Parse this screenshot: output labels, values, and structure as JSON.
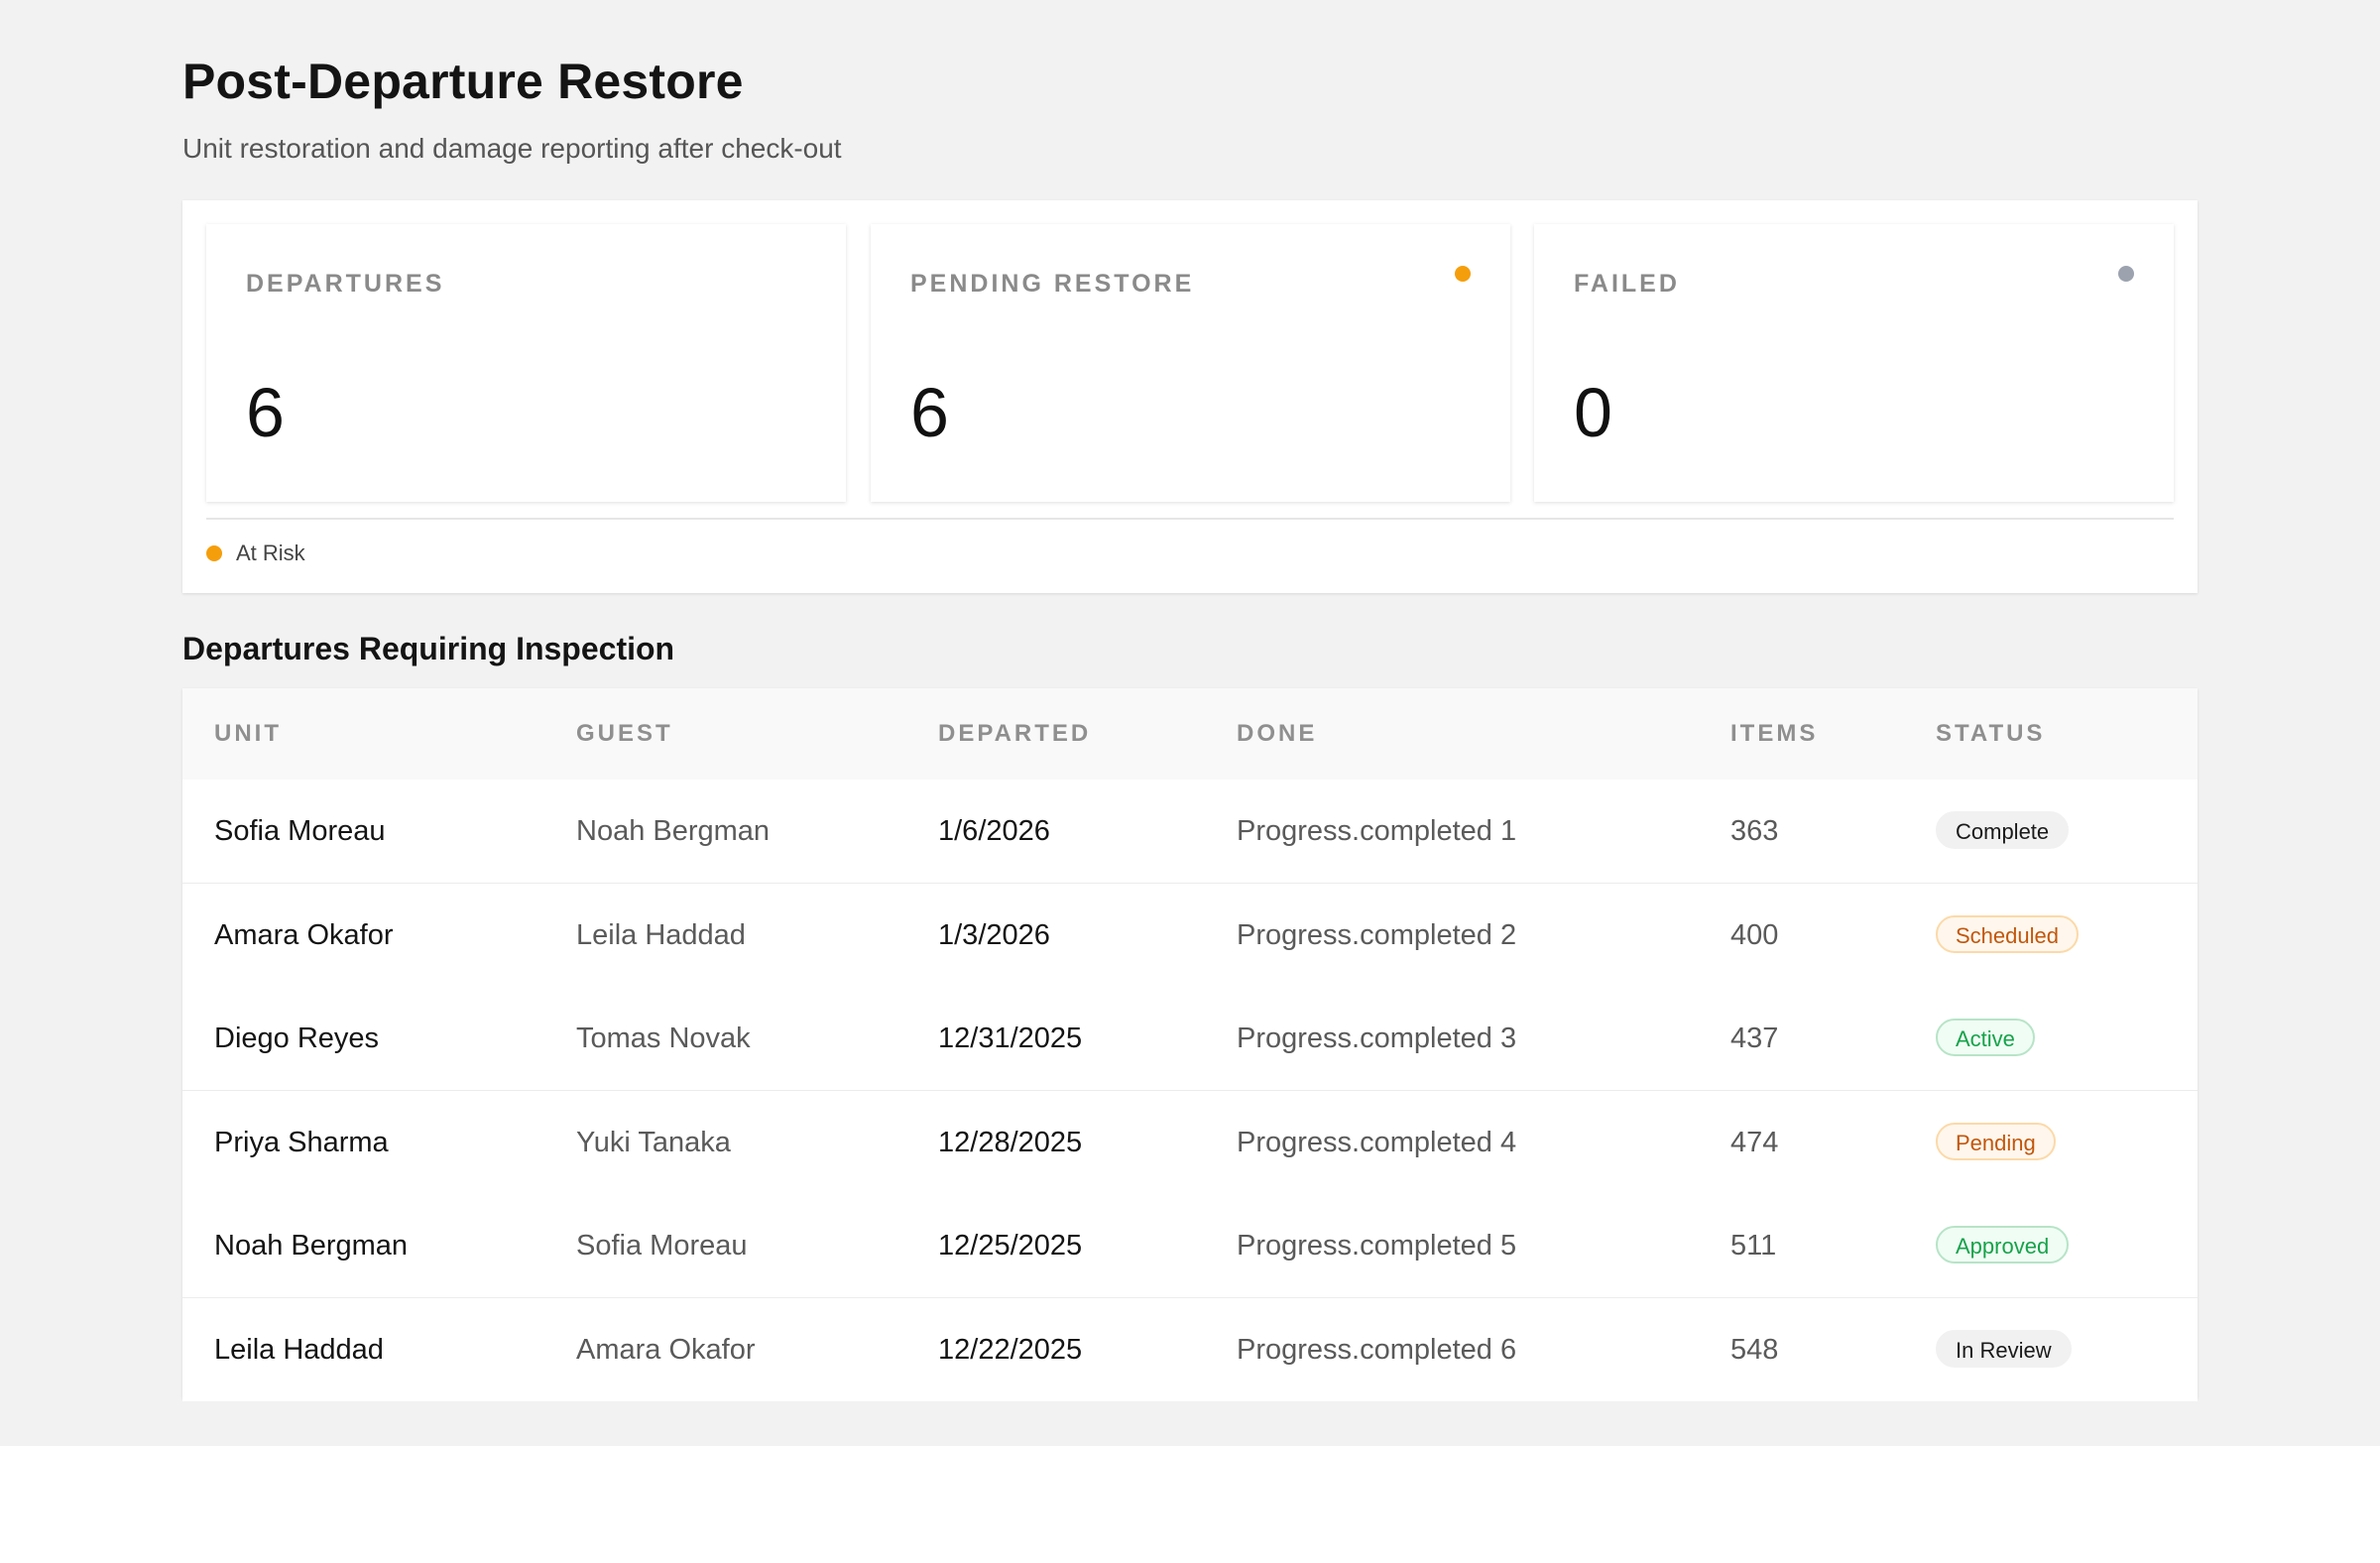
{
  "header": {
    "title": "Post-Departure Restore",
    "subtitle": "Unit restoration and damage reporting after check-out"
  },
  "stats": [
    {
      "label": "DEPARTURES",
      "value": "6"
    },
    {
      "label": "PENDING RESTORE",
      "value": "6",
      "dot_color": "#f59e0b"
    },
    {
      "label": "FAILED",
      "value": "0",
      "dot_color": "#9ca3af"
    }
  ],
  "legend": {
    "label": "At Risk",
    "color": "#f59e0b"
  },
  "table": {
    "title": "Departures Requiring Inspection",
    "columns": [
      "UNIT",
      "GUEST",
      "DEPARTED",
      "DONE",
      "ITEMS",
      "STATUS"
    ],
    "rows": [
      {
        "unit": "Sofia Moreau",
        "guest": "Noah Bergman",
        "departed": "1/6/2026",
        "done": "Progress.completed 1",
        "items": "363",
        "status": "Complete",
        "status_style": "neutral"
      },
      {
        "unit": "Amara Okafor",
        "guest": "Leila Haddad",
        "departed": "1/3/2026",
        "done": "Progress.completed 2",
        "items": "400",
        "status": "Scheduled",
        "status_style": "warning"
      },
      {
        "unit": "Diego Reyes",
        "guest": "Tomas Novak",
        "departed": "12/31/2025",
        "done": "Progress.completed 3",
        "items": "437",
        "status": "Active",
        "status_style": "success"
      },
      {
        "unit": "Priya Sharma",
        "guest": "Yuki Tanaka",
        "departed": "12/28/2025",
        "done": "Progress.completed 4",
        "items": "474",
        "status": "Pending",
        "status_style": "warning"
      },
      {
        "unit": "Noah Bergman",
        "guest": "Sofia Moreau",
        "departed": "12/25/2025",
        "done": "Progress.completed 5",
        "items": "511",
        "status": "Approved",
        "status_style": "success"
      },
      {
        "unit": "Leila Haddad",
        "guest": "Amara Okafor",
        "departed": "12/22/2025",
        "done": "Progress.completed 6",
        "items": "548",
        "status": "In Review",
        "status_style": "neutral"
      }
    ]
  },
  "colors": {
    "page_background": "#f2f2f2",
    "warning": "#f59e0b",
    "success": "#16a34a",
    "neutral_badge": "#f1f1f1"
  }
}
